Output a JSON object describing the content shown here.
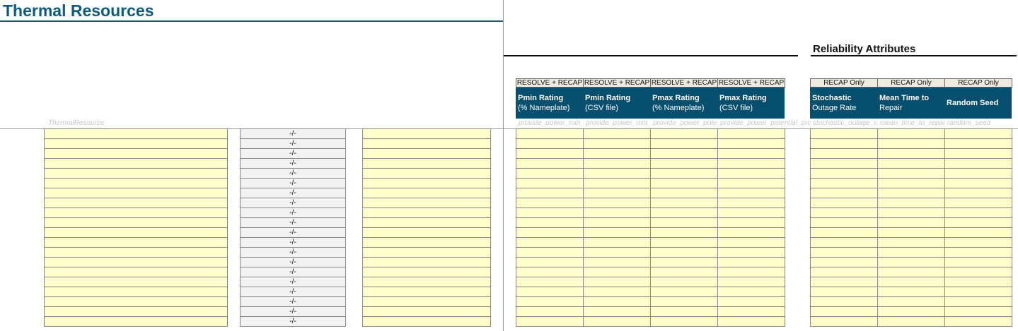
{
  "title": "Thermal Resources",
  "reliability_title": "Reliability Attributes",
  "first_col_key": "ThermalResource",
  "row_count": 20,
  "calc_value": "-/-",
  "operational_columns": [
    {
      "tag": "RESOLVE + RECAP",
      "label1": "Pmin Rating",
      "label2": "(% Nameplate)",
      "key": "provide_power_min_pot"
    },
    {
      "tag": "RESOLVE + RECAP",
      "label1": "Pmin Rating",
      "label2": "(CSV file)",
      "key": "provide_power_min_profile"
    },
    {
      "tag": "RESOLVE + RECAP",
      "label1": "Pmax Rating",
      "label2": "(% Nameplate)",
      "key": "provide_power_potential"
    },
    {
      "tag": "RESOLVE + RECAP",
      "label1": "Pmax Rating",
      "label2": "(CSV file)",
      "key": "provide_power_potential_profile"
    }
  ],
  "reliability_columns": [
    {
      "tag": "RECAP Only",
      "label1": "Stochastic",
      "label2": "Outage Rate",
      "key": "stochastic_outage_rate"
    },
    {
      "tag": "RECAP Only",
      "label1": "Mean Time to",
      "label2": "Repair",
      "key": "mean_time_to_repair"
    },
    {
      "tag": "RECAP Only",
      "label1": "Random Seed",
      "label2": "",
      "key": "random_seed"
    }
  ],
  "colors": {
    "header": "#064f6e",
    "input": "#ffffcc",
    "calc": "#f2f2f2"
  }
}
